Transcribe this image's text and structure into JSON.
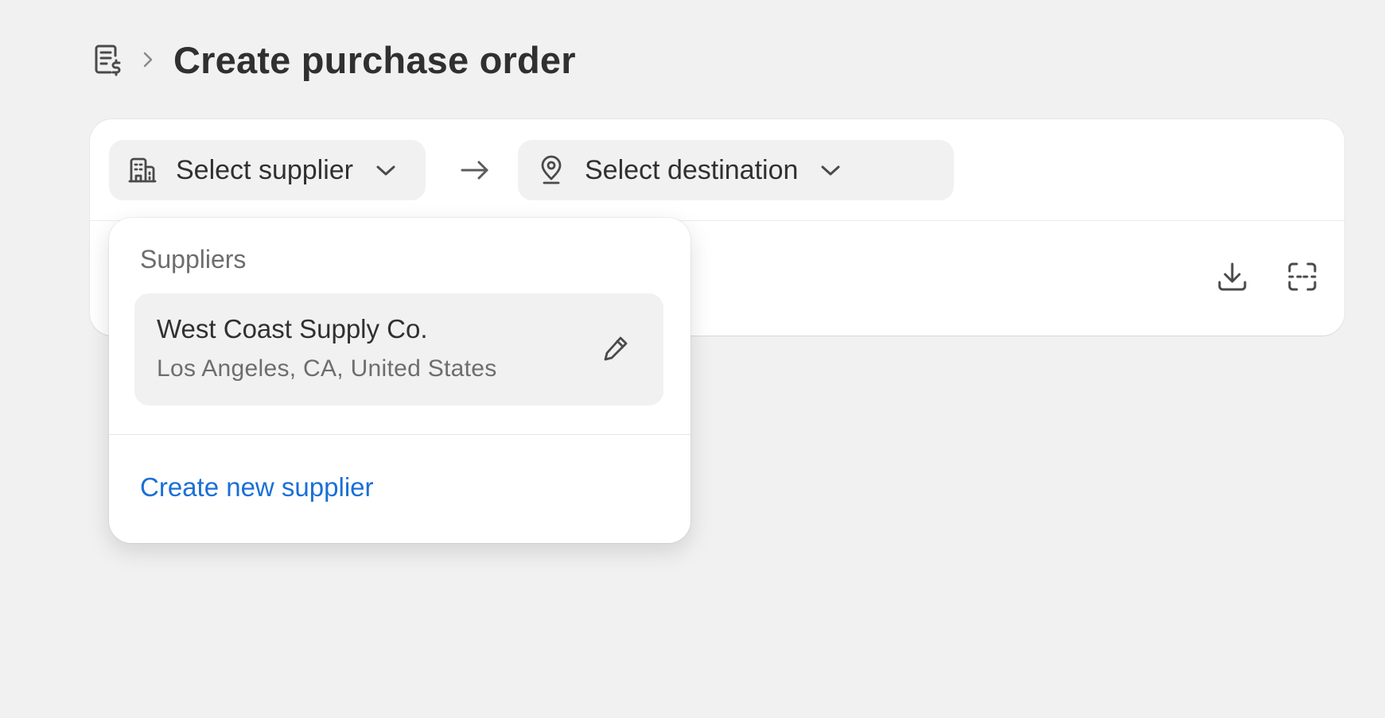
{
  "header": {
    "breadcrumb_icon": "purchase-order-icon",
    "separator_icon": "chevron-right-icon",
    "title": "Create purchase order"
  },
  "supplier_select": {
    "label": "Select supplier",
    "icon": "building-icon",
    "chevron": "chevron-down-icon"
  },
  "flow_arrow_icon": "arrow-right-icon",
  "destination_select": {
    "label": "Select destination",
    "icon": "location-pin-icon",
    "chevron": "chevron-down-icon"
  },
  "card_actions": {
    "download_icon": "download-icon",
    "scan_icon": "scan-barcode-icon"
  },
  "supplier_popover": {
    "heading": "Suppliers",
    "suppliers": [
      {
        "name": "West Coast Supply Co.",
        "location": "Los Angeles, CA, United States",
        "edit_icon": "pencil-icon"
      }
    ],
    "create_link": "Create new supplier"
  },
  "colors": {
    "background": "#f1f1f1",
    "card": "#ffffff",
    "text": "#303030",
    "subdued_text": "#6d6d6d",
    "link": "#1a6fd6"
  }
}
